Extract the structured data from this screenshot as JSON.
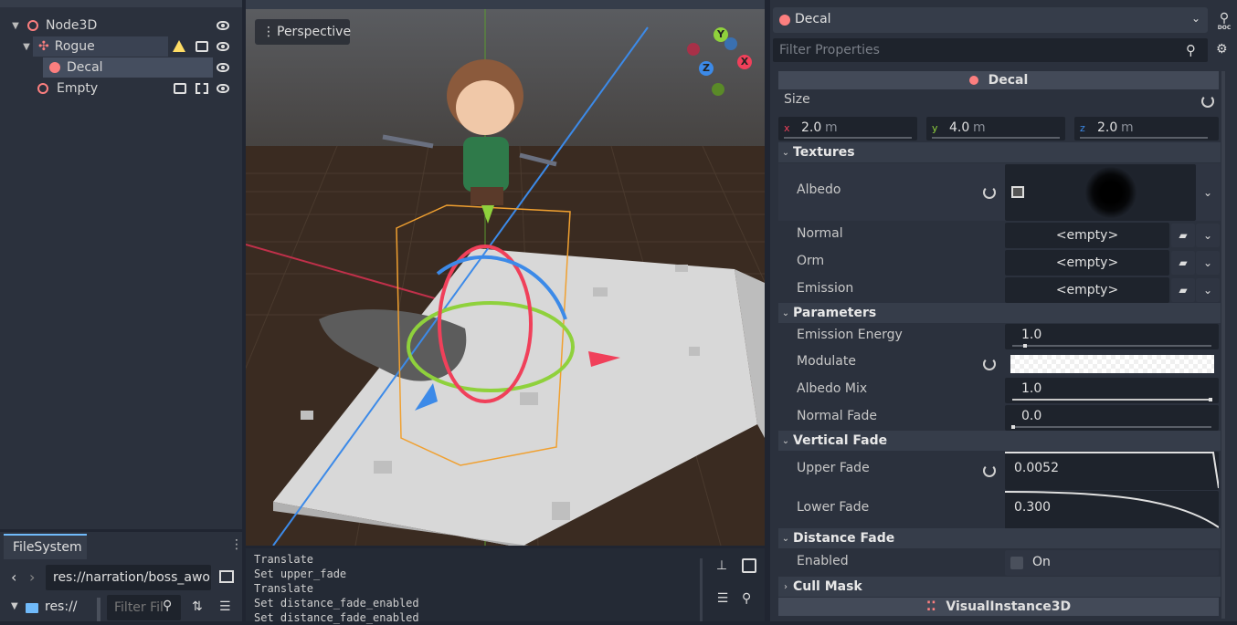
{
  "scene_tree": {
    "nodes": [
      {
        "label": "Node3D"
      },
      {
        "label": "Rogue"
      },
      {
        "label": "Decal"
      },
      {
        "label": "Empty"
      }
    ]
  },
  "viewport": {
    "view_mode": "Perspective",
    "gizmo_axes": [
      "Y",
      "X",
      "Z"
    ]
  },
  "output_log": {
    "lines": [
      "Translate",
      "Set upper_fade",
      "Translate",
      "Set distance_fade_enabled",
      "Set distance_fade_enabled"
    ]
  },
  "filesystem": {
    "tab_label": "FileSystem",
    "path": "res://narration/boss_awo",
    "root_label": "res://",
    "filter_placeholder": "Filter Fil"
  },
  "inspector": {
    "object_name": "Decal",
    "filter_placeholder": "Filter Properties",
    "doc_label": "DOC",
    "header_title": "Decal",
    "size": {
      "label": "Size",
      "x_axis": "x",
      "x_value": "2.0",
      "x_unit": "m",
      "y_axis": "y",
      "y_value": "4.0",
      "y_unit": "m",
      "z_axis": "z",
      "z_value": "2.0",
      "z_unit": "m"
    },
    "textures": {
      "title": "Textures",
      "albedo_label": "Albedo",
      "normal_label": "Normal",
      "normal_value": "<empty>",
      "orm_label": "Orm",
      "orm_value": "<empty>",
      "emission_label": "Emission",
      "emission_value": "<empty>"
    },
    "parameters": {
      "title": "Parameters",
      "emission_energy_label": "Emission Energy",
      "emission_energy_value": "1.0",
      "modulate_label": "Modulate",
      "albedo_mix_label": "Albedo Mix",
      "albedo_mix_value": "1.0",
      "normal_fade_label": "Normal Fade",
      "normal_fade_value": "0.0"
    },
    "vertical_fade": {
      "title": "Vertical Fade",
      "upper_fade_label": "Upper Fade",
      "upper_fade_value": "0.0052",
      "lower_fade_label": "Lower Fade",
      "lower_fade_value": "0.300"
    },
    "distance_fade": {
      "title": "Distance Fade",
      "enabled_label": "Enabled",
      "enabled_checkbox_label": "On"
    },
    "cull_mask": {
      "title": "Cull Mask"
    },
    "footer_title": "VisualInstance3D"
  },
  "colors": {
    "node_icon": "#fc7f7f",
    "accent": "#70bafa",
    "axis_x": "#f0405a",
    "axis_y": "#8fd13c",
    "axis_z": "#3c8ae8"
  }
}
